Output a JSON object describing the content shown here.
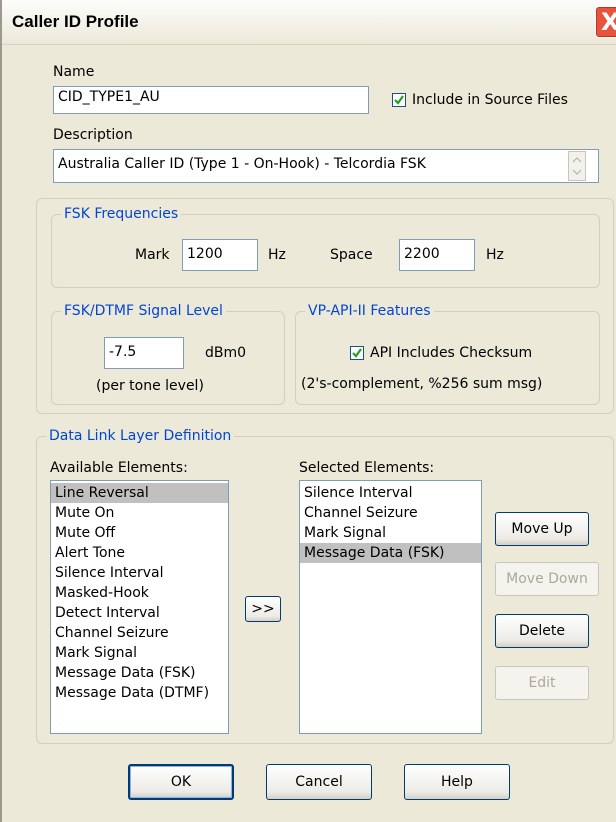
{
  "window": {
    "title": "Caller ID Profile",
    "close_label": "X"
  },
  "name": {
    "label": "Name",
    "value": "CID_TYPE1_AU"
  },
  "include_source": {
    "label": "Include in Source Files",
    "checked": true
  },
  "description": {
    "label": "Description",
    "value": "Australia Caller ID (Type 1 - On-Hook) - Telcordia FSK"
  },
  "fsk_freq": {
    "title": "FSK Frequencies",
    "mark_label": "Mark",
    "mark_value": "1200",
    "mark_unit": "Hz",
    "space_label": "Space",
    "space_value": "2200",
    "space_unit": "Hz"
  },
  "signal_level": {
    "title": "FSK/DTMF Signal Level",
    "value": "-7.5",
    "unit": "dBm0",
    "note": "(per tone level)"
  },
  "vp_api": {
    "title": "VP-API-II Features",
    "checksum_label": "API Includes Checksum",
    "checksum_checked": true,
    "note": "(2's-complement, %256 sum msg)"
  },
  "data_link": {
    "title": "Data Link Layer Definition",
    "available_label": "Available Elements:",
    "selected_label": "Selected Elements:",
    "available": [
      "Line Reversal",
      "Mute On",
      "Mute Off",
      "Alert Tone",
      "Silence Interval",
      "Masked-Hook",
      "Detect Interval",
      "Channel Seizure",
      "Mark Signal",
      "Message Data (FSK)",
      "Message Data (DTMF)"
    ],
    "selected": [
      "Silence Interval",
      "Channel Seizure",
      "Mark Signal",
      "Message Data (FSK)"
    ],
    "add_label": ">>",
    "move_up_label": "Move Up",
    "move_down_label": "Move Down",
    "delete_label": "Delete",
    "edit_label": "Edit"
  },
  "footer": {
    "ok_label": "OK",
    "cancel_label": "Cancel",
    "help_label": "Help"
  },
  "colors": {
    "group_title": "#0046d5",
    "dialog_bg": "#ece9d8",
    "selection": "#c0c0c0"
  }
}
